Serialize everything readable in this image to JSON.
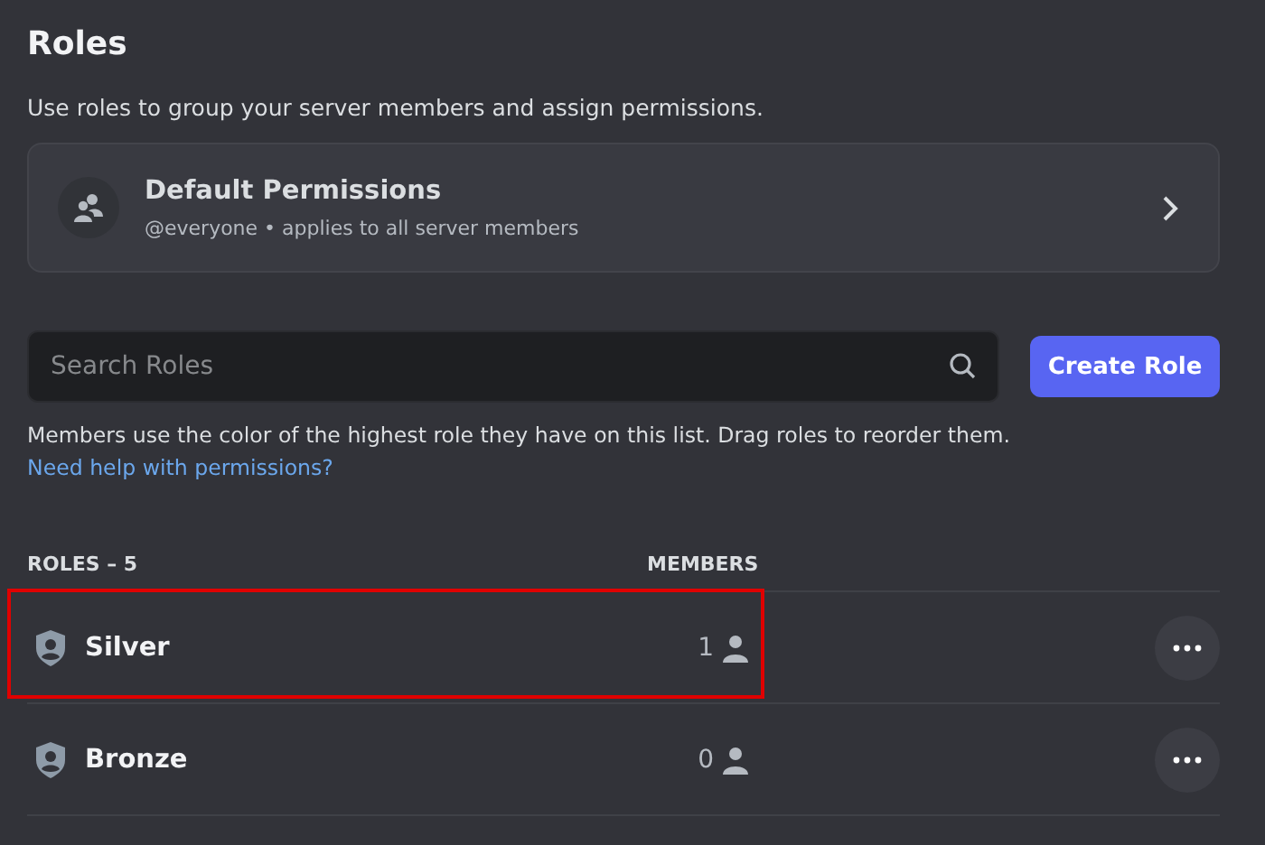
{
  "title": "Roles",
  "description": "Use roles to group your server members and assign permissions.",
  "default_permissions": {
    "title": "Default Permissions",
    "subtitle": "@everyone • applies to all server members"
  },
  "search": {
    "placeholder": "Search Roles"
  },
  "create_button": "Create Role",
  "help": {
    "text": "Members use the color of the highest role they have on this list. Drag roles to reorder them.",
    "link": "Need help with permissions?"
  },
  "table": {
    "columns": [
      "ROLES – 5",
      "MEMBERS"
    ],
    "rows": [
      {
        "name": "Silver",
        "members": "1",
        "highlighted": true
      },
      {
        "name": "Bronze",
        "members": "0",
        "highlighted": false
      }
    ]
  }
}
